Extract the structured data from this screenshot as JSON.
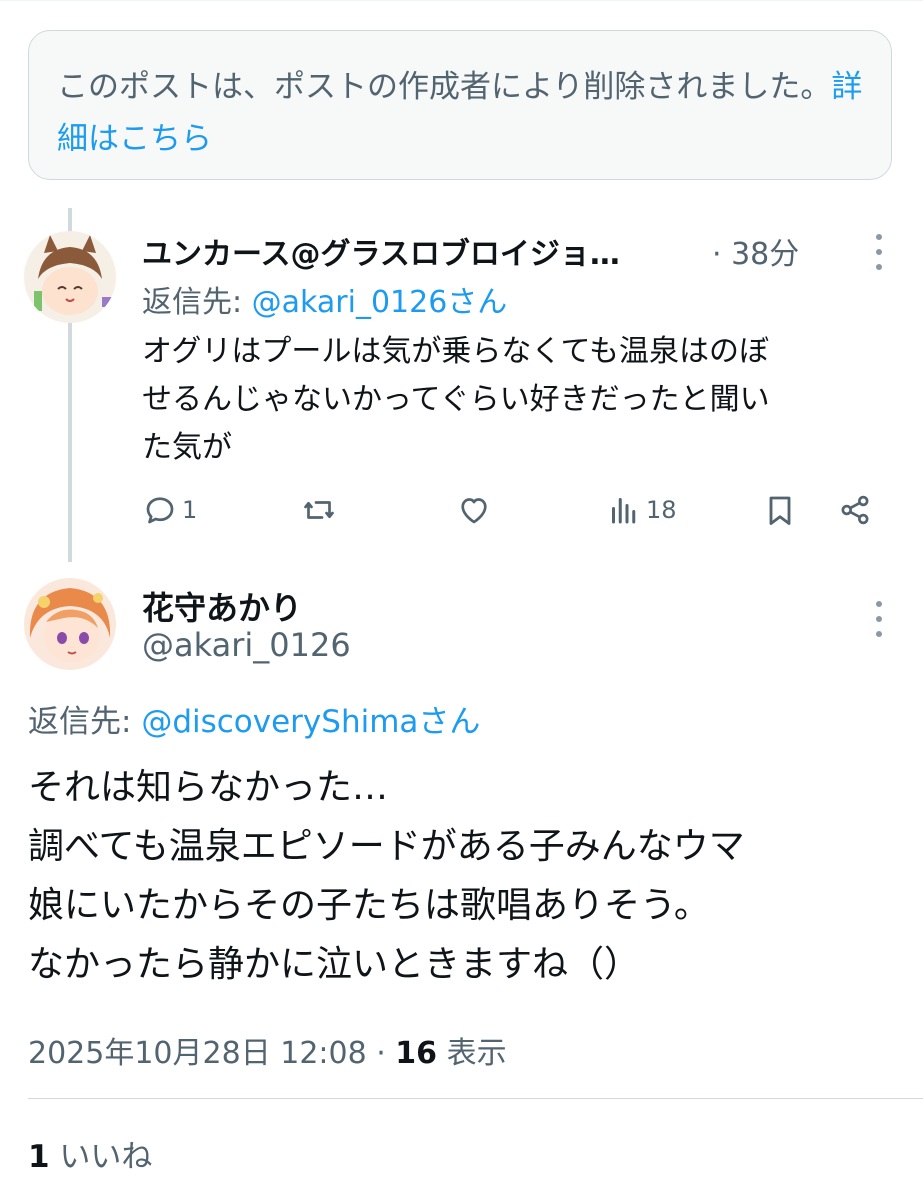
{
  "deleted_notice": {
    "text": "このポストは、ポストの作成者により削除されました。",
    "link_label": "詳細はこちら"
  },
  "reply_post": {
    "author_name": "ユンカース@グラスロブロイジョ…",
    "time": "· 38分",
    "reply_prefix": "返信先: ",
    "reply_handle": "@akari_0126さん",
    "body_lines": [
      "オグリはプールは気が乗らなくても温泉はのぼ",
      "せるんじゃないかってぐらい好きだったと聞い",
      "た気が"
    ],
    "actions": {
      "reply_count": "1",
      "retweet_count": "",
      "like_count": "",
      "views_count": "18"
    }
  },
  "main_post": {
    "author_name": "花守あかり",
    "handle": "@akari_0126",
    "reply_prefix": "返信先: ",
    "reply_handle": "@discoveryShimaさん",
    "body_lines": [
      "それは知らなかった…",
      "調べても温泉エピソードがある子みんなウマ",
      "娘にいたからその子たちは歌唱ありそう。",
      "なかったら静かに泣いときますね（）"
    ],
    "date": "2025年10月28日 12:08 · ",
    "views_number": "16",
    "views_label": " 表示",
    "likes_number": "1",
    "likes_label": " いいね"
  },
  "colors": {
    "link": "#1d9bf0",
    "secondary_text": "#536471",
    "primary_text": "#0f1419",
    "border": "#cfd9de"
  },
  "icons": [
    "more-icon",
    "reply-icon",
    "retweet-icon",
    "like-icon",
    "views-icon",
    "bookmark-icon",
    "share-icon"
  ]
}
